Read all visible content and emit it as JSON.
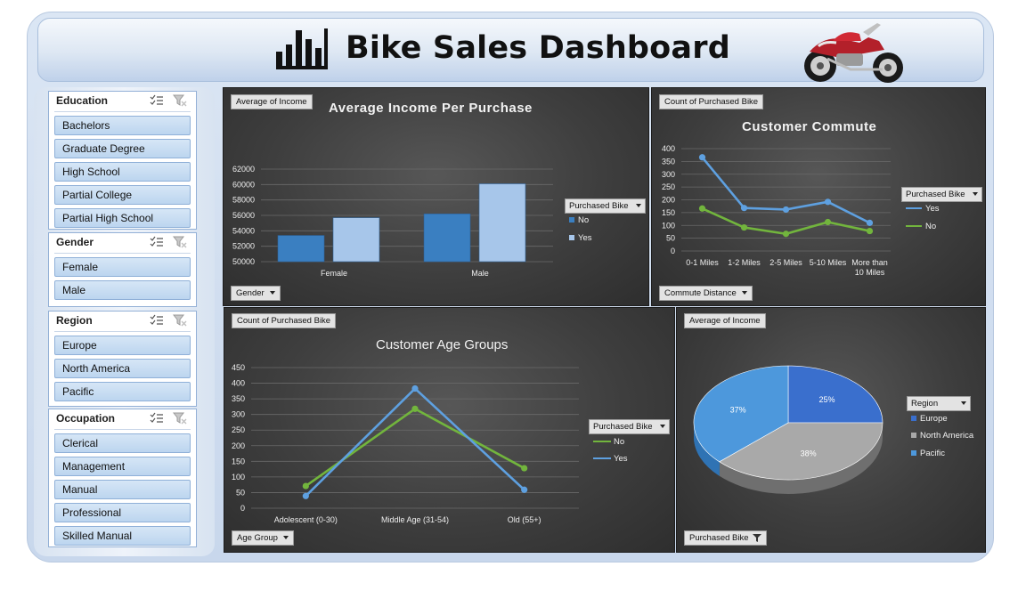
{
  "header": {
    "title": "Bike Sales Dashboard"
  },
  "slicers": {
    "education": {
      "title": "Education",
      "items": [
        "Bachelors",
        "Graduate Degree",
        "High School",
        "Partial College",
        "Partial High School"
      ]
    },
    "gender": {
      "title": "Gender",
      "items": [
        "Female",
        "Male"
      ]
    },
    "region": {
      "title": "Region",
      "items": [
        "Europe",
        "North America",
        "Pacific"
      ]
    },
    "occupation": {
      "title": "Occupation",
      "items": [
        "Clerical",
        "Management",
        "Manual",
        "Professional",
        "Skilled Manual"
      ]
    }
  },
  "colors": {
    "series_no": "#3a7fc1",
    "series_yes": "#a7c6ea",
    "line_yes": "#5ea0e0",
    "line_no": "#72b53d",
    "pie_europe": "#3a6fcd",
    "pie_na": "#a9a9a9",
    "pie_pacific": "#4d98dc"
  },
  "panels": {
    "income": {
      "value_button": "Average of Income",
      "axis_button": "Gender",
      "legend_button": "Purchased Bike"
    },
    "commute": {
      "value_button": "Count of Purchased Bike",
      "axis_button": "Commute Distance",
      "legend_button": "Purchased Bike"
    },
    "age": {
      "value_button": "Count of Purchased Bike",
      "axis_button": "Age Group",
      "legend_button": "Purchased Bike"
    },
    "region": {
      "value_button": "Average of Income",
      "filter_button": "Purchased Bike",
      "legend_button": "Region"
    }
  },
  "chart_data": [
    {
      "id": "income",
      "type": "bar",
      "title": "Average Income Per Purchase",
      "categories": [
        "Female",
        "Male"
      ],
      "series": [
        {
          "name": "No",
          "values": [
            53400,
            56200
          ]
        },
        {
          "name": "Yes",
          "values": [
            55700,
            60100
          ]
        }
      ],
      "y_ticks": [
        "50000",
        "52000",
        "54000",
        "56000",
        "58000",
        "60000",
        "62000"
      ],
      "ylim": [
        50000,
        62000
      ],
      "grid": true,
      "legend": "right"
    },
    {
      "id": "commute",
      "type": "line",
      "title": "Customer Commute",
      "categories": [
        "0-1 Miles",
        "1-2 Miles",
        "2-5 Miles",
        "5-10 Miles",
        "More than 10 Miles"
      ],
      "series": [
        {
          "name": "Yes",
          "values": [
            366,
            168,
            162,
            192,
            110
          ]
        },
        {
          "name": "No",
          "values": [
            166,
            92,
            67,
            113,
            78
          ]
        }
      ],
      "y_ticks": [
        "0",
        "50",
        "100",
        "150",
        "200",
        "250",
        "300",
        "350",
        "400"
      ],
      "ylim": [
        0,
        400
      ],
      "grid": true,
      "legend": "right"
    },
    {
      "id": "age",
      "type": "line",
      "title": "Customer Age Groups",
      "categories": [
        "Adolescent (0-30)",
        "Middle Age (31-54)",
        "Old (55+)"
      ],
      "series": [
        {
          "name": "No",
          "values": [
            71,
            318,
            128
          ]
        },
        {
          "name": "Yes",
          "values": [
            39,
            383,
            59
          ]
        }
      ],
      "y_ticks": [
        "0",
        "50",
        "100",
        "150",
        "200",
        "250",
        "300",
        "350",
        "400",
        "450"
      ],
      "ylim": [
        0,
        450
      ],
      "grid": true,
      "legend": "right"
    },
    {
      "id": "region",
      "type": "pie",
      "categories": [
        "Europe",
        "North America",
        "Pacific"
      ],
      "values": [
        25,
        38,
        37
      ],
      "labels": [
        "25%",
        "38%",
        "37%"
      ],
      "legend": "right"
    }
  ]
}
